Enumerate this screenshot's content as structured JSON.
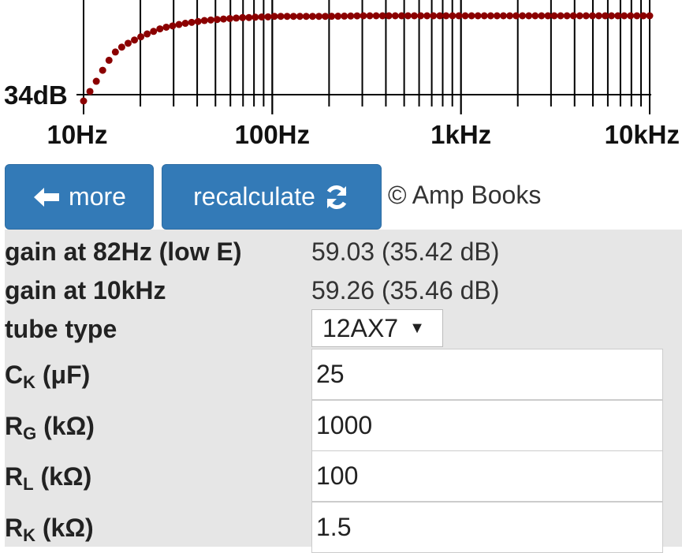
{
  "chart_data": {
    "type": "line",
    "x_scale": "log",
    "xlim": [
      10,
      10000
    ],
    "ylabel_tick": "34dB",
    "x_tick_labels": [
      {
        "value": 10,
        "label": "10Hz"
      },
      {
        "value": 100,
        "label": "100Hz"
      },
      {
        "value": 1000,
        "label": "1kHz"
      },
      {
        "value": 10000,
        "label": "10kHz"
      }
    ],
    "series_color": "#8b0000",
    "grid": "vertical log grid",
    "series": [
      {
        "x": [
          10,
          11,
          12,
          13,
          14,
          15,
          17,
          19,
          21,
          23,
          25,
          27,
          30,
          33,
          36,
          40,
          44,
          48,
          53,
          58,
          64,
          70,
          77,
          85,
          94,
          100,
          150,
          200,
          300,
          500,
          1000,
          2000,
          5000,
          10000
        ],
        "y": [
          34.0,
          34.2,
          34.4,
          34.6,
          34.75,
          34.87,
          34.98,
          35.06,
          35.13,
          35.18,
          35.23,
          35.26,
          35.29,
          35.32,
          35.34,
          35.36,
          35.38,
          35.39,
          35.4,
          35.41,
          35.42,
          35.43,
          35.43,
          35.44,
          35.44,
          35.45,
          35.45,
          35.45,
          35.46,
          35.46,
          35.46,
          35.46,
          35.46,
          35.46
        ]
      }
    ]
  },
  "buttons": {
    "more_label": "more",
    "recalc_label": "recalculate"
  },
  "copyright": "© Amp Books",
  "results": {
    "gain_low_label": "gain at 82Hz (low E)",
    "gain_low_value": "59.03 (35.42 dB)",
    "gain_high_label": "gain at 10kHz",
    "gain_high_value": "59.26 (35.46 dB)"
  },
  "params": {
    "tube_label": "tube type",
    "tube_value": "12AX7",
    "ck_main": "C",
    "ck_sub": "K",
    "ck_unit": " (μF)",
    "ck_value": "25",
    "rg_main": "R",
    "rg_sub": "G",
    "rg_unit": " (kΩ)",
    "rg_value": "1000",
    "rl_main": "R",
    "rl_sub": "L",
    "rl_unit": " (kΩ)",
    "rl_value": "100",
    "rk_main": "R",
    "rk_sub": "K",
    "rk_unit": " (kΩ)",
    "rk_value": "1.5"
  }
}
